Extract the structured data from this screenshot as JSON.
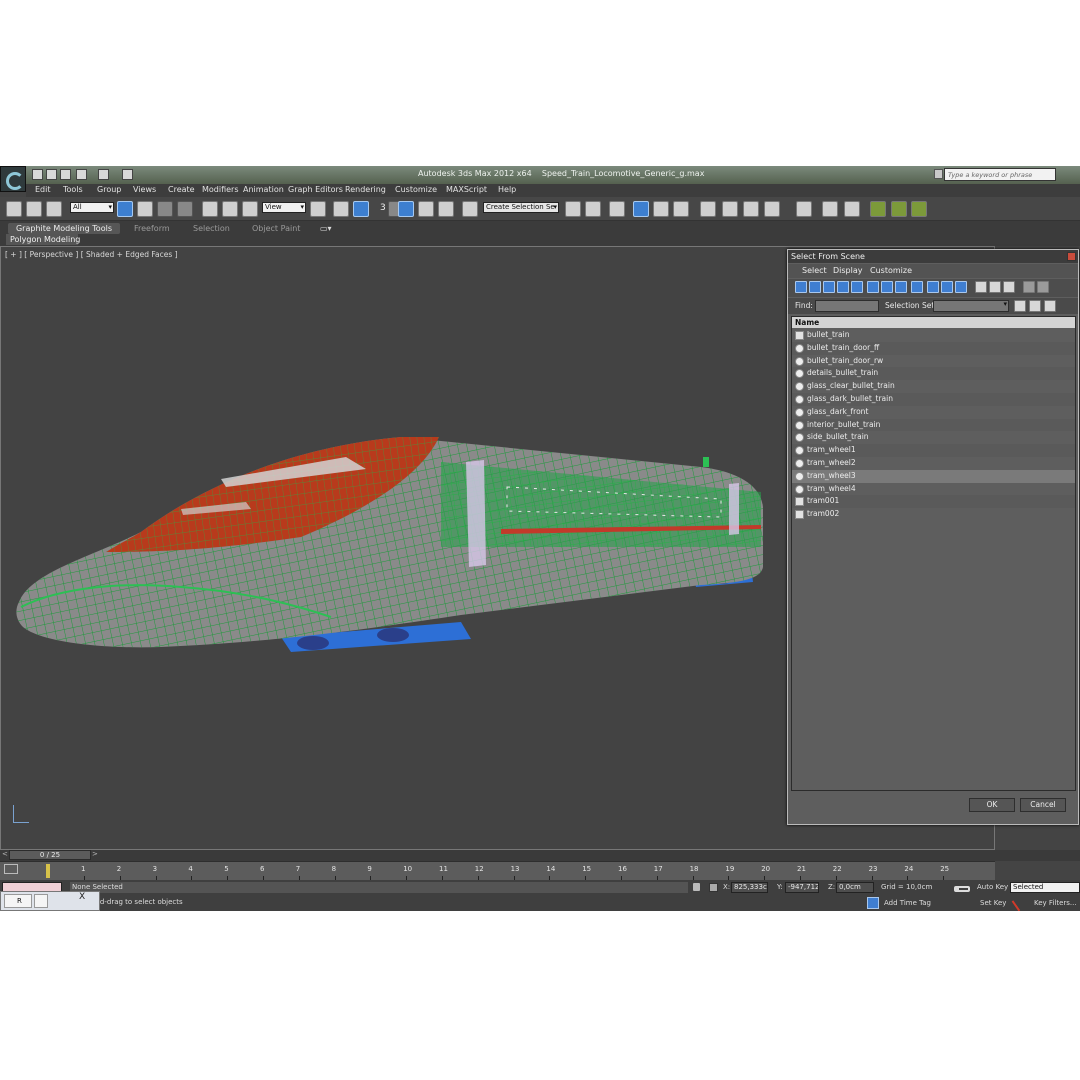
{
  "titlebar": {
    "app_title": "Autodesk 3ds Max  2012 x64",
    "file_name": "Speed_Train_Locomotive_Generic_g.max",
    "search_placeholder": "Type a keyword or phrase"
  },
  "menu": [
    "Edit",
    "Tools",
    "Group",
    "Views",
    "Create",
    "Modifiers",
    "Animation",
    "Graph Editors",
    "Rendering",
    "Customize",
    "MAXScript",
    "Help"
  ],
  "toolbar": {
    "selection_filter": "All",
    "ref_coord": "View",
    "snap_label": "3",
    "named_selection_placeholder": "Create Selection Se"
  },
  "ribbon": {
    "tabs": [
      "Graphite Modeling Tools",
      "Freeform",
      "Selection",
      "Object Paint"
    ],
    "panel_label": "Polygon Modeling"
  },
  "viewport": {
    "label": "[ + ] [ Perspective ] [ Shaded + Edged Faces ]"
  },
  "timeline": {
    "frame_display": "0 / 25",
    "left_arrow": "<",
    "right_arrow": ">",
    "ticks": [
      "1",
      "2",
      "3",
      "4",
      "5",
      "6",
      "7",
      "8",
      "9",
      "10",
      "11",
      "12",
      "13",
      "14",
      "15",
      "16",
      "17",
      "18",
      "19",
      "20",
      "21",
      "22",
      "23",
      "24",
      "25"
    ]
  },
  "status": {
    "selection_msg": "None Selected",
    "prompt_msg": "Click-and-drag to select objects",
    "x_label": "X:",
    "x_value": "825,333cm",
    "y_label": "Y:",
    "y_value": "-947,712c",
    "z_label": "Z:",
    "z_value": "0,0cm",
    "grid": "Grid = 10,0cm",
    "add_time_tag": "Add Time Tag",
    "auto_key": "Auto Key",
    "set_key": "Set Key",
    "key_mode": "Selected",
    "key_filters": "Key Filters..."
  },
  "taskbar": {
    "task_label": "R",
    "close_glyph": "X"
  },
  "dialog": {
    "title": "Select From Scene",
    "menu": [
      "Select",
      "Display",
      "Customize"
    ],
    "find_label": "Find:",
    "selection_set_label": "Selection Set:",
    "column_header": "Name",
    "items": [
      {
        "name": "bullet_train",
        "icon": "mesh-icon"
      },
      {
        "name": "bullet_train_door_ff",
        "icon": "sphere-icon"
      },
      {
        "name": "bullet_train_door_rw",
        "icon": "sphere-icon"
      },
      {
        "name": "details_bullet_train",
        "icon": "sphere-icon"
      },
      {
        "name": "glass_clear_bullet_train",
        "icon": "sphere-icon"
      },
      {
        "name": "glass_dark_bullet_train",
        "icon": "sphere-icon"
      },
      {
        "name": "glass_dark_front",
        "icon": "sphere-icon"
      },
      {
        "name": "interior_bullet_train",
        "icon": "sphere-icon"
      },
      {
        "name": "side_bullet_train",
        "icon": "sphere-icon"
      },
      {
        "name": "tram_wheel1",
        "icon": "sphere-icon"
      },
      {
        "name": "tram_wheel2",
        "icon": "sphere-icon"
      },
      {
        "name": "tram_wheel3",
        "icon": "sphere-icon"
      },
      {
        "name": "tram_wheel4",
        "icon": "sphere-icon"
      },
      {
        "name": "tram001",
        "icon": "mesh-icon"
      },
      {
        "name": "tram002",
        "icon": "mesh-icon"
      }
    ],
    "highlighted_item": "tram_wheel3",
    "ok": "OK",
    "cancel": "Cancel"
  },
  "colors": {
    "wire_green": "#1f9a3c",
    "body_grey": "#8a8a8a",
    "roof_red": "#b83a1c",
    "bogie_blue": "#2d6fd6",
    "viewport_bg": "#434343"
  }
}
